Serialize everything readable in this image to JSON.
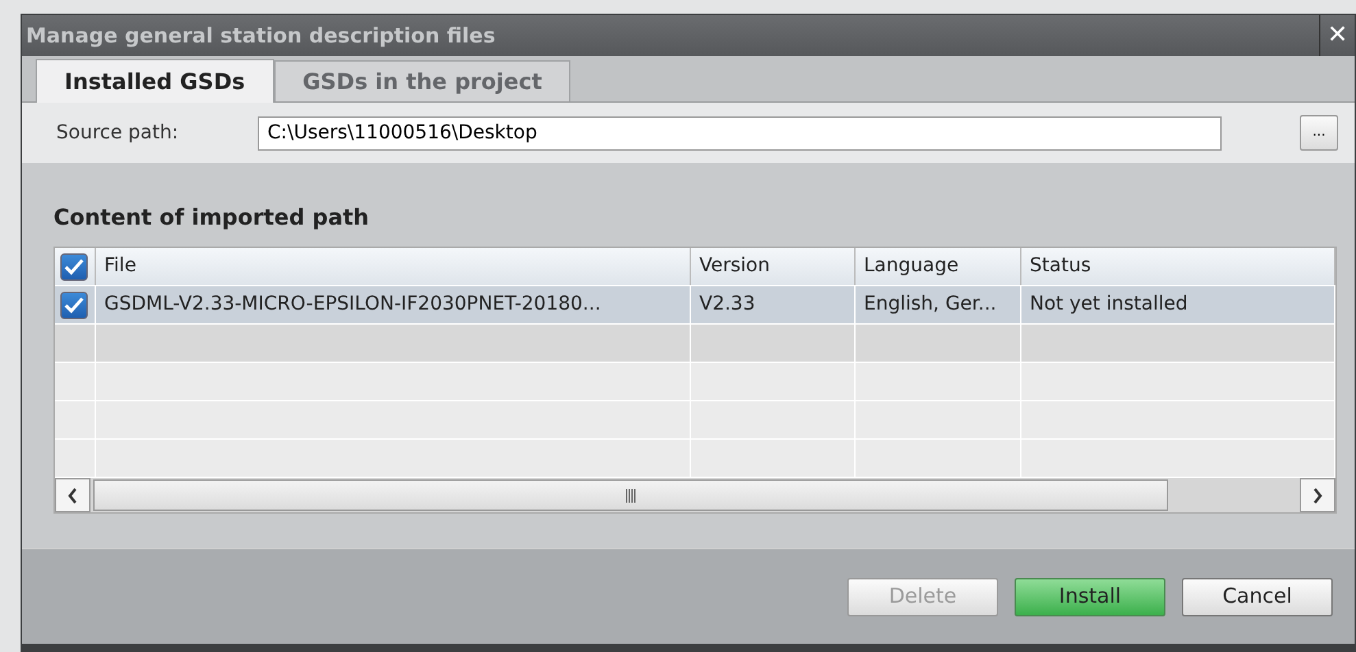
{
  "window": {
    "title": "Manage general station description files",
    "close": "✕"
  },
  "tabs": [
    {
      "label": "Installed GSDs",
      "selected": true
    },
    {
      "label": "GSDs in the project",
      "selected": false
    }
  ],
  "source_path": {
    "label": "Source path:",
    "value": "C:\\Users\\11000516\\Desktop",
    "browse": "..."
  },
  "section_title": "Content of imported path",
  "table": {
    "select_all_checked": true,
    "columns": [
      "File",
      "Version",
      "Language",
      "Status"
    ],
    "rows": [
      {
        "checked": true,
        "selected": true,
        "cells": [
          "GSDML-V2.33-MICRO-EPSILON-IF2030PNET-20180...",
          "V2.33",
          "English, Ger...",
          "Not yet installed"
        ]
      }
    ]
  },
  "buttons": [
    {
      "label": "Delete",
      "kind": "normal",
      "disabled": true
    },
    {
      "label": "Install",
      "kind": "primary",
      "disabled": false
    },
    {
      "label": "Cancel",
      "kind": "normal",
      "disabled": false
    }
  ]
}
